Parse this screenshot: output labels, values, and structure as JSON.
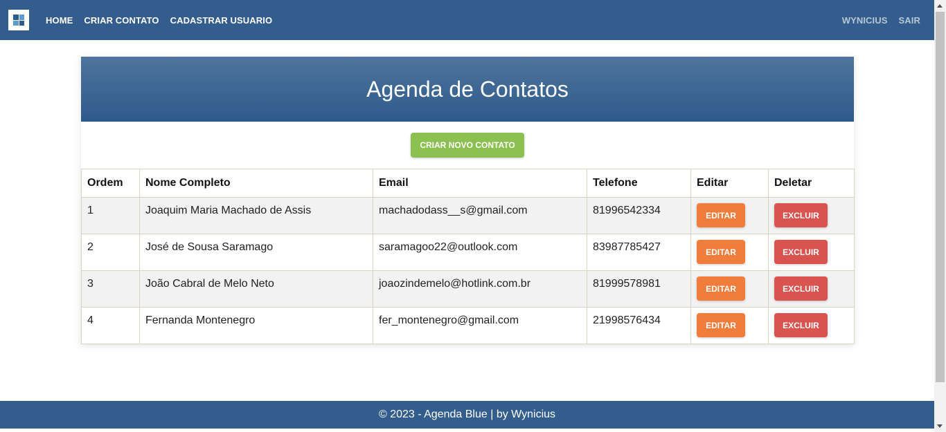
{
  "nav": {
    "logo_icon": "app-logo-icon",
    "links": [
      "HOME",
      "CRIAR CONTATO",
      "CADASTRAR USUARIO"
    ],
    "user": "WYNICIUS",
    "logout": "SAIR"
  },
  "main": {
    "title": "Agenda de Contatos",
    "new_contact_button": "CRIAR NOVO CONTATO"
  },
  "table": {
    "headers": [
      "Ordem",
      "Nome Completo",
      "Email",
      "Telefone",
      "Editar",
      "Deletar"
    ],
    "rows": [
      {
        "ordem": "1",
        "nome": "Joaquim Maria Machado de Assis",
        "email": "machadodass__s@gmail.com",
        "telefone": "81996542334"
      },
      {
        "ordem": "2",
        "nome": "José de Sousa Saramago",
        "email": "saramagoo22@outlook.com",
        "telefone": "83987785427"
      },
      {
        "ordem": "3",
        "nome": "João Cabral de Melo Neto",
        "email": "joaozindemelo@hotlink.com.br",
        "telefone": "81999578981"
      },
      {
        "ordem": "4",
        "nome": "Fernanda Montenegro",
        "email": "fer_montenegro@gmail.com",
        "telefone": "21998576434"
      }
    ],
    "edit_label": "EDITAR",
    "delete_label": "EXCLUIR"
  },
  "footer": {
    "text": "© 2023 - Agenda Blue | by Wynicius"
  },
  "colors": {
    "nav_bg": "#335d8c",
    "primary_green": "#8cc152",
    "edit_orange": "#f07d3c",
    "delete_red": "#d9534f"
  }
}
